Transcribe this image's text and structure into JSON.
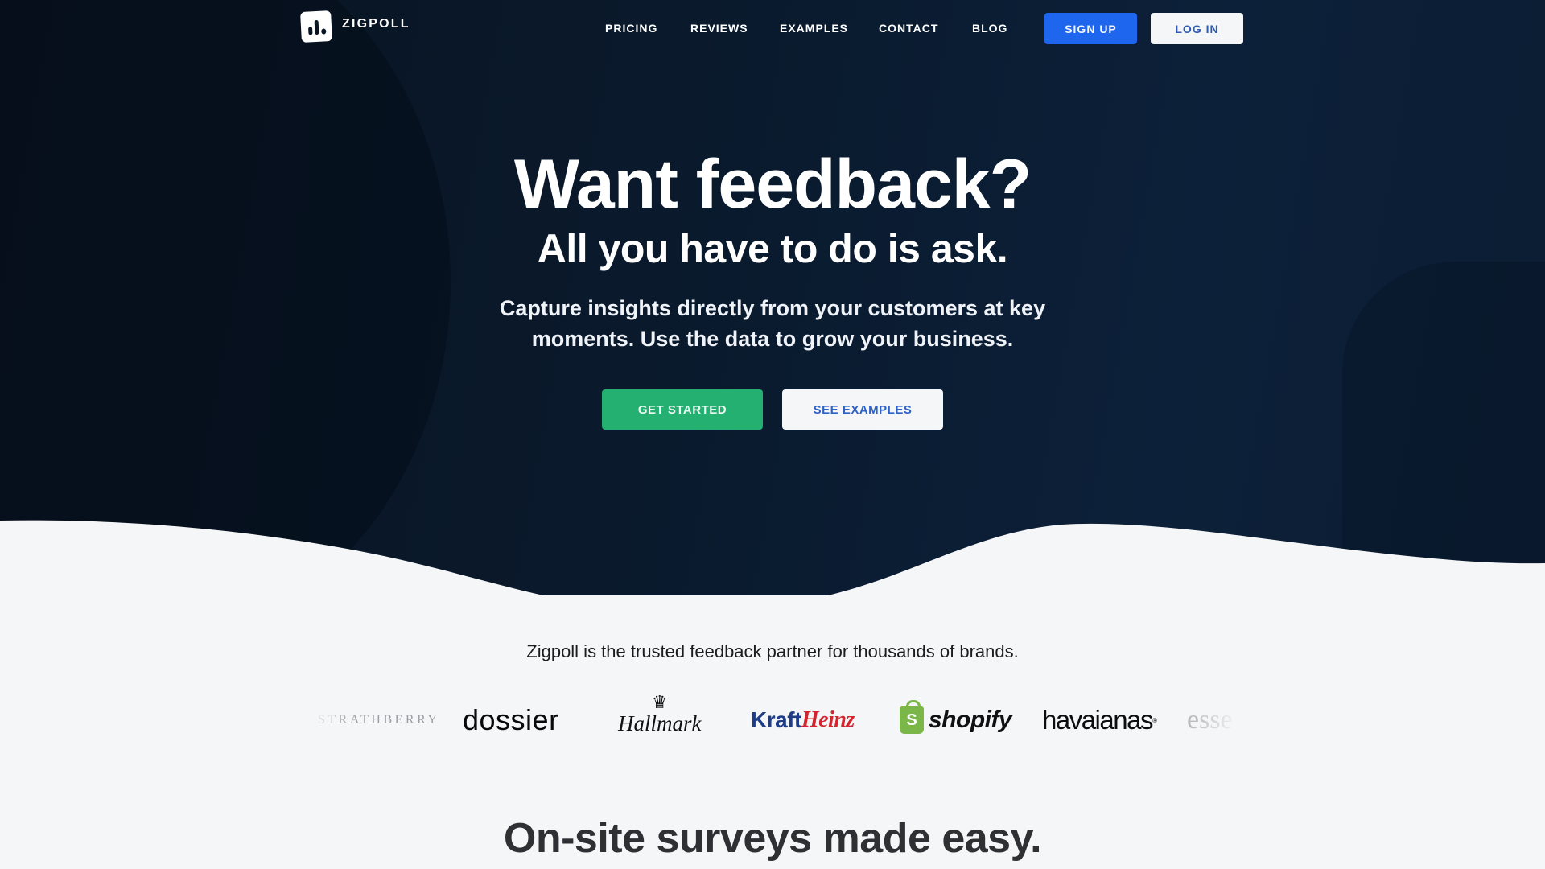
{
  "header": {
    "brand": "ZIGPOLL",
    "nav": [
      {
        "label": "PRICING"
      },
      {
        "label": "REVIEWS"
      },
      {
        "label": "EXAMPLES"
      },
      {
        "label": "CONTACT"
      },
      {
        "label": "BLOG"
      }
    ],
    "signup_label": "SIGN UP",
    "login_label": "LOG IN"
  },
  "hero": {
    "title": "Want feedback?",
    "subtitle": "All you have to do is ask.",
    "lead": "Capture insights directly from your customers at key moments. Use the data to grow your business.",
    "primary_cta": "GET STARTED",
    "secondary_cta": "SEE EXAMPLES"
  },
  "brands": {
    "tagline": "Zigpoll is the trusted feedback partner for thousands of brands.",
    "logos": {
      "strathberry": "STRATHBERRY",
      "dossier": "dossier",
      "hallmark": "Hallmark",
      "kraft": "Kraft",
      "heinz": "Heinz",
      "shopify_mark": "S",
      "shopify": "shopify",
      "havaianas": "havaianas",
      "havaianas_mark": "®",
      "esse": "esse"
    }
  },
  "section": {
    "heading": "On-site surveys made easy."
  },
  "colors": {
    "hero_bg": "#0a1a2d",
    "signup_blue": "#1f66ee",
    "cta_green": "#23b070",
    "link_blue": "#2d62c9",
    "page_bg": "#f5f6f8"
  }
}
